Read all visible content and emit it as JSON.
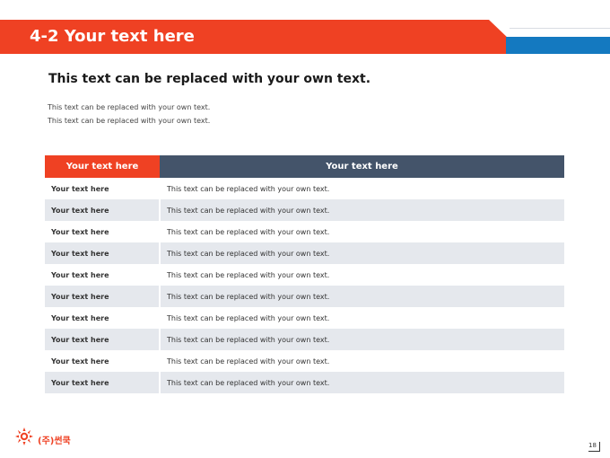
{
  "header": {
    "title": "4-2 Your text here"
  },
  "content": {
    "heading": "This text can be replaced with your own text.",
    "lines": [
      "This text can be replaced with your own text.",
      "This text can be replaced with your own text."
    ]
  },
  "table": {
    "columns": [
      "Your text here",
      "Your text here"
    ],
    "rows": [
      [
        "Your text here",
        "This text can be replaced with your own text."
      ],
      [
        "Your text here",
        "This text can be replaced with your own text."
      ],
      [
        "Your text here",
        "This text can be replaced with your own text."
      ],
      [
        "Your text here",
        "This text can be replaced with your own text."
      ],
      [
        "Your text here",
        "This text can be replaced with your own text."
      ],
      [
        "Your text here",
        "This text can be replaced with your own text."
      ],
      [
        "Your text here",
        "This text can be replaced with your own text."
      ],
      [
        "Your text here",
        "This text can be replaced with your own text."
      ],
      [
        "Your text here",
        "This text can be replaced with your own text."
      ],
      [
        "Your text here",
        "This text can be replaced with your own text."
      ]
    ]
  },
  "footer": {
    "logo_text": "(주)썬쿡",
    "page_number": "18"
  },
  "colors": {
    "accent_red": "#ef4123",
    "accent_blue": "#1479c0",
    "header_slate": "#44546a",
    "row_alt": "#e5e8ed"
  },
  "icons": {
    "logo": "sun-logo-icon"
  }
}
